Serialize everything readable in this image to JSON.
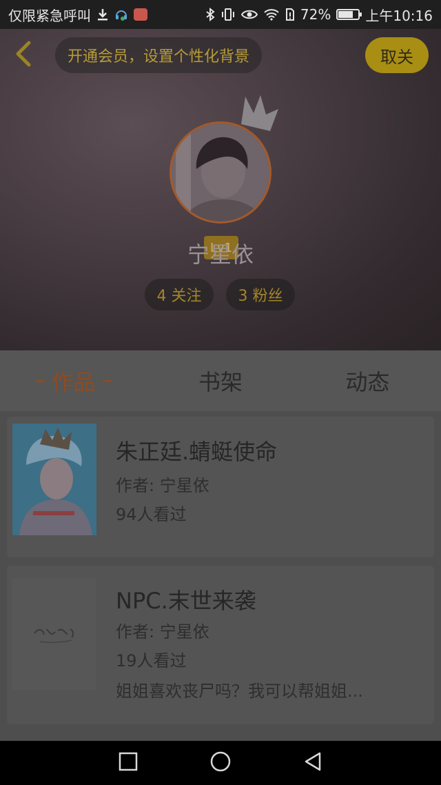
{
  "status_bar": {
    "left_text": "仅限紧急呼叫",
    "battery_percent": 72,
    "battery_label": "72%",
    "time": "上午10:16",
    "icons": [
      "download-icon",
      "headset-icon",
      "app-icon",
      "bluetooth-icon",
      "vibrate-icon",
      "eye-icon",
      "wifi-icon",
      "sim-icon",
      "battery-icon"
    ]
  },
  "header": {
    "vip_prompt": "开通会员，设置个性化背景",
    "cancel_label": "取关",
    "level": "Lv1",
    "username": "宁星依",
    "follow_label": "4 关注",
    "fans_label": "3 粉丝"
  },
  "tabs": [
    {
      "label": "作品",
      "active": true
    },
    {
      "label": "书架",
      "active": false
    },
    {
      "label": "动态",
      "active": false
    }
  ],
  "works": [
    {
      "title": "朱正廷.蜻蜓使命",
      "author": "作者: 宁星依",
      "views": "94人看过",
      "desc": ""
    },
    {
      "title": "NPC.末世来袭",
      "author": "作者: 宁星依",
      "views": "19人看过",
      "desc": "姐姐喜欢丧尸吗？我可以帮姐姐..."
    }
  ],
  "colors": {
    "accent_orange": "#8d4b22",
    "accent_gold": "#a98e14"
  }
}
